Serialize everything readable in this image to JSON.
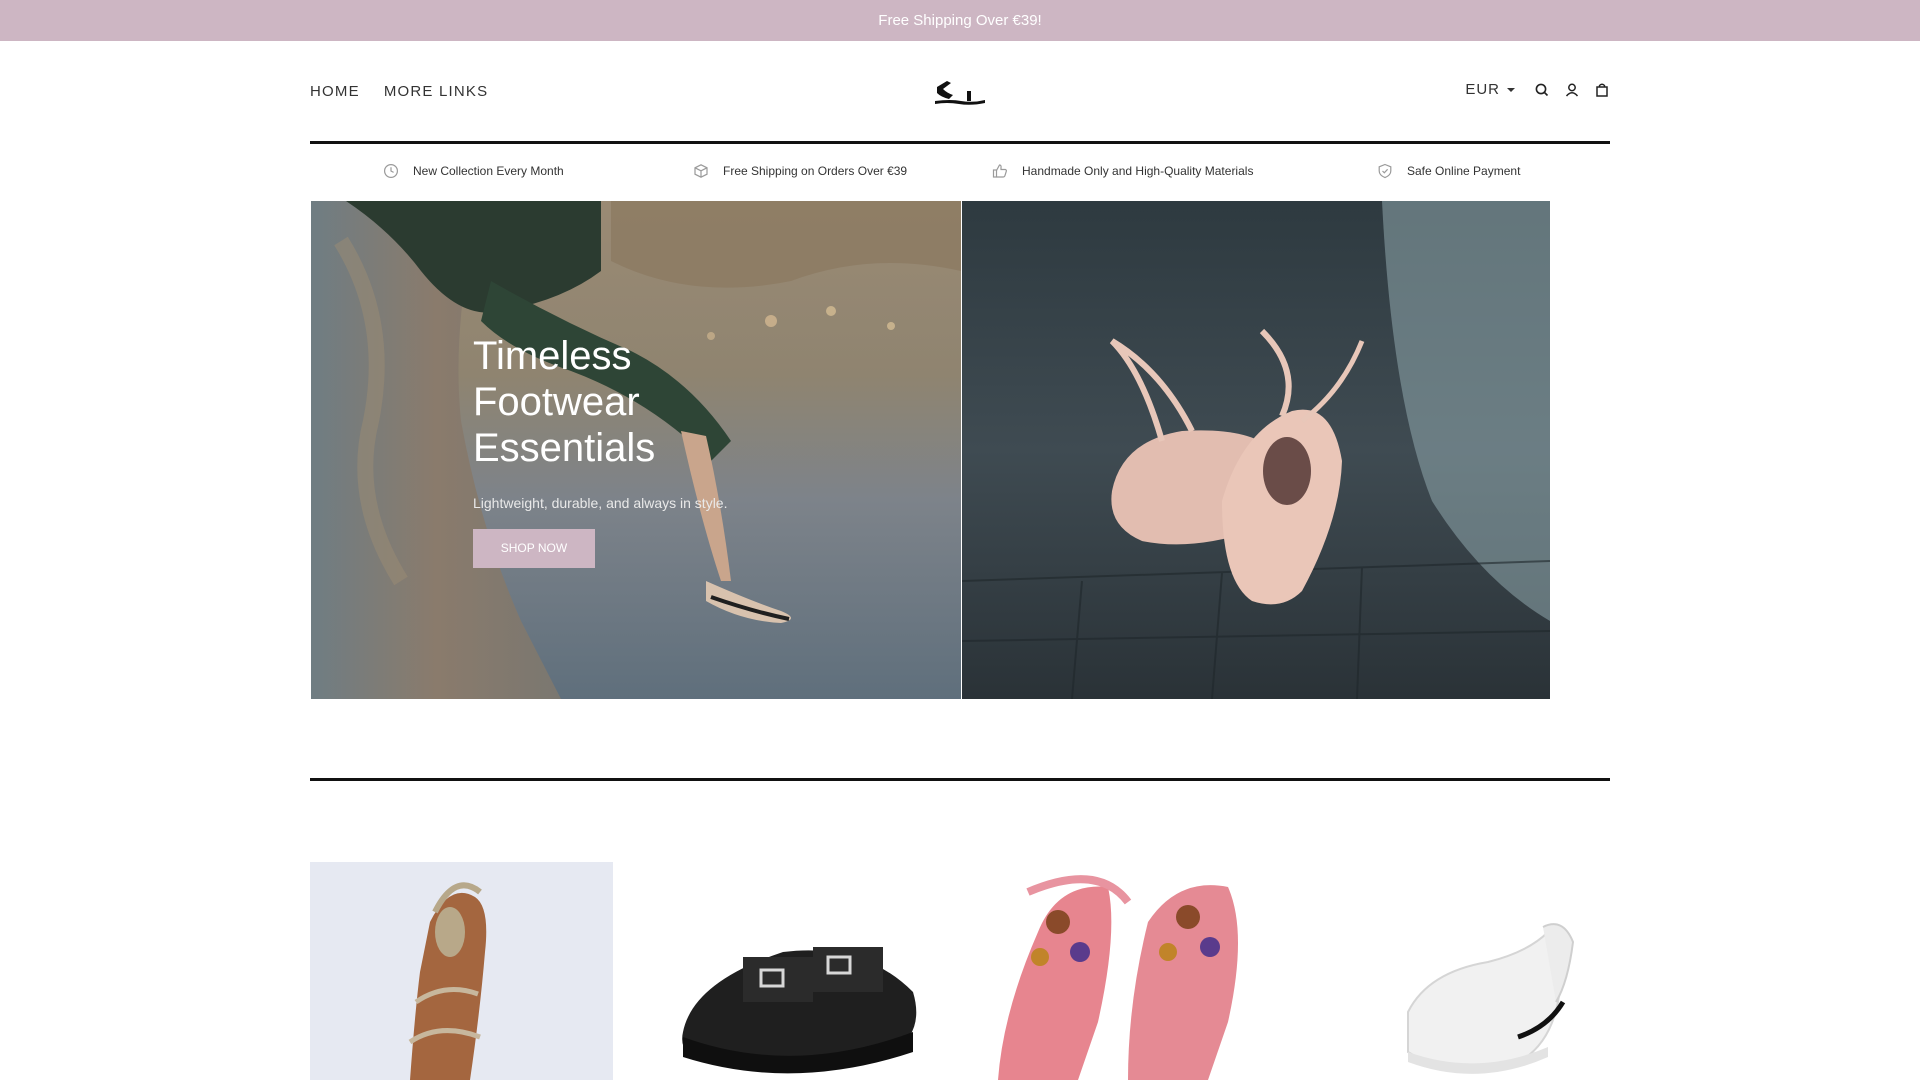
{
  "announcement": {
    "text": "Free Shipping Over €39!"
  },
  "header": {
    "nav": [
      {
        "label": "HOME"
      },
      {
        "label": "MORE LINKS"
      }
    ],
    "logo_icon": "sandal-logo",
    "currency": "EUR",
    "icons": [
      "search-icon",
      "account-icon",
      "cart-icon"
    ]
  },
  "features": [
    {
      "icon": "clock-icon",
      "text": "New Collection Every Month"
    },
    {
      "icon": "box-icon",
      "text": "Free Shipping on Orders Over €39"
    },
    {
      "icon": "thumbs-up-icon",
      "text": "Handmade Only and High-Quality Materials"
    },
    {
      "icon": "shield-check-icon",
      "text": "Safe Online Payment"
    }
  ],
  "hero": {
    "title": "Timeless Footwear Essentials",
    "subtitle": "Lightweight, durable, and always in style.",
    "button": "SHOP NOW"
  },
  "products": [
    {
      "image": "strappy-heel-sandal"
    },
    {
      "image": "black-buckle-slide"
    },
    {
      "image": "pink-beaded-thong-sandal"
    },
    {
      "image": "white-sport-sandal"
    }
  ],
  "colors": {
    "accent": "#cdb6c3",
    "rule": "#111111",
    "text": "#333333"
  }
}
